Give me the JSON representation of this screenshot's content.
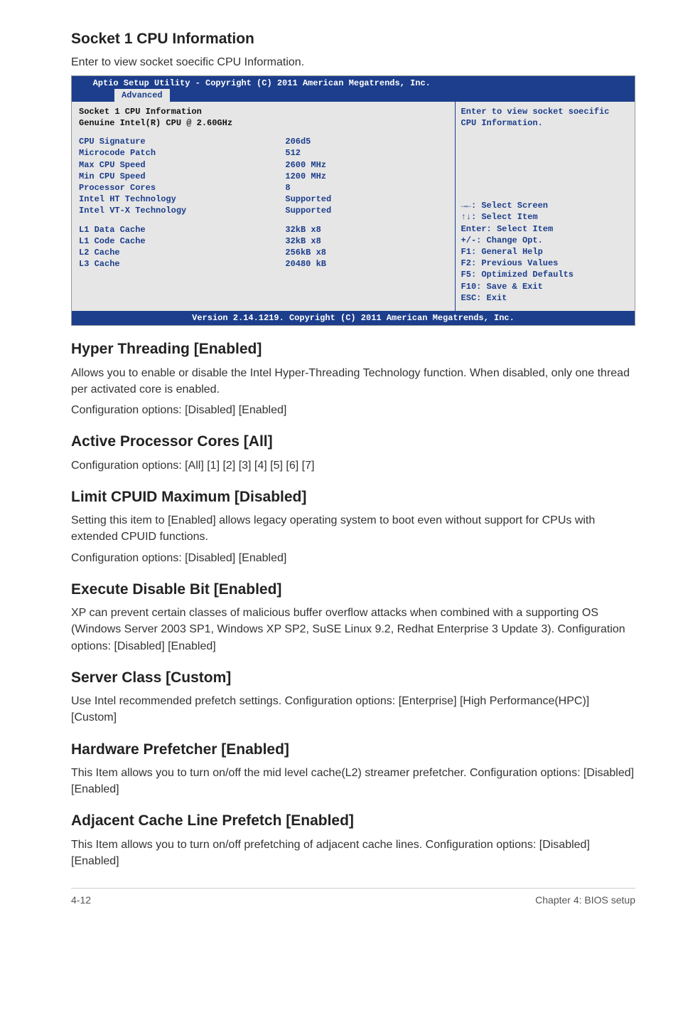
{
  "sections": {
    "socket_info": {
      "heading": "Socket 1 CPU Information",
      "desc": "Enter to view socket soecific CPU Information."
    },
    "hyper_threading": {
      "heading": "Hyper Threading [Enabled]",
      "p1": "Allows you to enable or disable the Intel Hyper-Threading Technology function. When disabled, only one thread per activated core is enabled.",
      "p2": "Configuration options: [Disabled] [Enabled]"
    },
    "active_cores": {
      "heading": "Active Processor Cores [All]",
      "p1": "Configuration options: [All] [1] [2] [3] [4] [5] [6] [7]"
    },
    "limit_cpuid": {
      "heading": "Limit CPUID Maximum [Disabled]",
      "p1": "Setting this item to [Enabled] allows legacy operating system to boot even without support for CPUs with extended CPUID functions.",
      "p2": "Configuration options: [Disabled] [Enabled]"
    },
    "execute_disable": {
      "heading": "Execute Disable Bit [Enabled]",
      "p1": "XP can prevent certain classes of malicious buffer overflow attacks when combined with a supporting OS (Windows Server 2003 SP1, Windows XP SP2, SuSE Linux 9.2, Redhat Enterprise 3 Update 3). Configuration options: [Disabled] [Enabled]"
    },
    "server_class": {
      "heading": "Server Class [Custom]",
      "p1": "Use Intel recommended prefetch settings. Configuration options: [Enterprise] [High Performance(HPC)] [Custom]"
    },
    "hw_prefetcher": {
      "heading": "Hardware Prefetcher [Enabled]",
      "p1": "This Item allows you to turn on/off the mid level cache(L2) streamer prefetcher. Configuration options: [Disabled] [Enabled]"
    },
    "adj_cache": {
      "heading": "Adjacent Cache Line Prefetch [Enabled]",
      "p1": "This Item allows you to turn on/off prefetching of adjacent cache lines. Configuration options: [Disabled] [Enabled]"
    }
  },
  "bios": {
    "titlebar": "   Aptio Setup Utility - Copyright (C) 2011 American Megatrends, Inc.",
    "tab": "Advanced",
    "left": {
      "header1": "Socket 1 CPU Information",
      "header2": "Genuine Intel(R) CPU @ 2.60GHz",
      "rows1": [
        {
          "lbl": "CPU Signature",
          "val": "206d5"
        },
        {
          "lbl": "Microcode Patch",
          "val": "512"
        },
        {
          "lbl": "Max CPU Speed",
          "val": "2600 MHz"
        },
        {
          "lbl": "Min CPU Speed",
          "val": "1200 MHz"
        },
        {
          "lbl": "Processor Cores",
          "val": "8"
        },
        {
          "lbl": "Intel HT Technology",
          "val": "Supported"
        },
        {
          "lbl": "Intel VT-X Technology",
          "val": "Supported"
        }
      ],
      "rows2": [
        {
          "lbl": "L1 Data Cache",
          "val": "32kB x8"
        },
        {
          "lbl": "L1 Code Cache",
          "val": "32kB x8"
        },
        {
          "lbl": "L2 Cache",
          "val": "256kB x8"
        },
        {
          "lbl": "L3 Cache",
          "val": "20480 kB"
        }
      ]
    },
    "right": {
      "help": "Enter to view socket soecific CPU Information.",
      "nav": [
        "→←: Select Screen",
        "↑↓:  Select Item",
        "Enter: Select Item",
        "+/-: Change Opt.",
        "F1: General Help",
        "F2: Previous Values",
        "F5: Optimized Defaults",
        "F10: Save & Exit",
        "ESC: Exit"
      ]
    },
    "footer": "Version 2.14.1219. Copyright (C) 2011 American Megatrends, Inc."
  },
  "pagefoot": {
    "left": "4-12",
    "right": "Chapter 4: BIOS setup"
  }
}
